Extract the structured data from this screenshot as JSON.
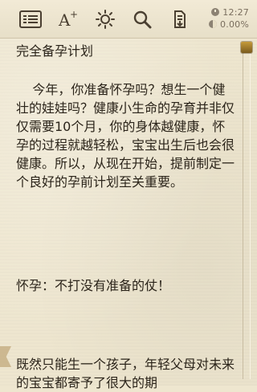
{
  "toolbar": {
    "icons": [
      "menu-icon",
      "font-size-icon",
      "brightness-icon",
      "search-icon",
      "save-icon"
    ]
  },
  "status": {
    "time": "12:27",
    "progress": "0.00%"
  },
  "article": {
    "title": "完全备孕计划",
    "paragraphs": [
      "    今年，你准备怀孕吗？想生一个健壮的娃娃吗？健康小生命的孕育并非仅仅需要10个月，你的身体越健康，怀孕的过程就越轻松，宝宝出生后也会很健康。所以，从现在开始，提前制定一个良好的孕前计划至关重要。",
      "怀孕：不打没有准备的仗！",
      "既然只能生一个孩子，年轻父母对未来的宝宝都寄予了很大的期"
    ]
  },
  "colors": {
    "background": "#eee6cf",
    "text": "#2b241a",
    "accent": "#b38a2f"
  }
}
